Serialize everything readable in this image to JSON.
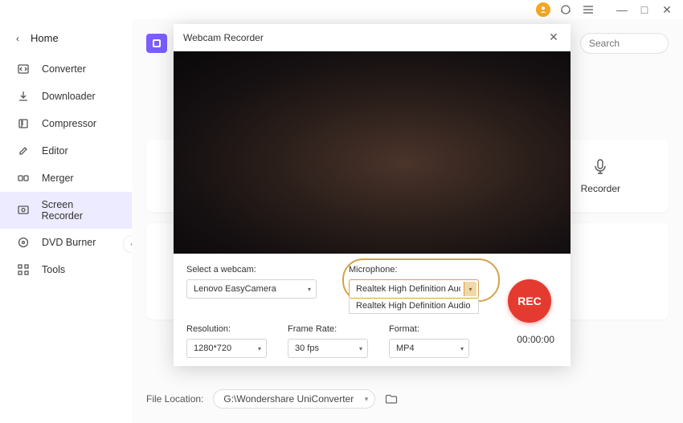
{
  "titlebar": {
    "avatar_glyph": "●",
    "headset": "◯",
    "menu": "≡",
    "min": "—",
    "max": "□",
    "close": "✕"
  },
  "sidebar": {
    "back_label": "Home",
    "items": [
      {
        "label": "Converter"
      },
      {
        "label": "Downloader"
      },
      {
        "label": "Compressor"
      },
      {
        "label": "Editor"
      },
      {
        "label": "Merger"
      },
      {
        "label": "Screen Recorder"
      },
      {
        "label": "DVD Burner"
      },
      {
        "label": "Tools"
      }
    ],
    "collapse": "‹"
  },
  "search": {
    "placeholder": "Search"
  },
  "features": {
    "audio_recorder": {
      "label": "Recorder"
    }
  },
  "modal": {
    "title": "Webcam Recorder",
    "webcam_label": "Select a webcam:",
    "webcam_value": "Lenovo EasyCamera",
    "mic_label": "Microphone:",
    "mic_value": "Realtek High Definition Audio",
    "mic_option": "Realtek High Definition Audio",
    "resolution_label": "Resolution:",
    "resolution_value": "1280*720",
    "framerate_label": "Frame Rate:",
    "framerate_value": "30 fps",
    "format_label": "Format:",
    "format_value": "MP4",
    "rec_label": "REC",
    "timer": "00:00:00"
  },
  "footer": {
    "label": "File Location:",
    "path": "G:\\Wondershare UniConverter"
  }
}
